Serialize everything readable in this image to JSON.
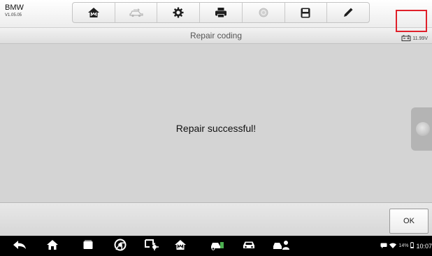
{
  "header": {
    "brand": "BMW",
    "version": "V1.05.05",
    "toolbar": [
      {
        "icon": "home-icon"
      },
      {
        "icon": "vehicle-swap-icon"
      },
      {
        "icon": "settings-gear-icon"
      },
      {
        "icon": "print-icon"
      },
      {
        "icon": "help-icon"
      },
      {
        "icon": "save-icon"
      },
      {
        "icon": "edit-pen-icon"
      }
    ]
  },
  "titlebar": {
    "title": "Repair coding",
    "battery_voltage": "11.99V",
    "battery_icon": "car-battery-icon"
  },
  "main": {
    "message": "Repair successful!"
  },
  "actions": {
    "ok_label": "OK",
    "highlight_color": "#e0202a"
  },
  "navbar": {
    "icons": [
      "back-icon",
      "android-home-icon",
      "recent-apps-icon",
      "chrome-icon",
      "vci-connection-icon",
      "autel-home-icon",
      "vehicle-service-icon",
      "car-icon",
      "vehicle-user-icon"
    ],
    "battery_percent": "14%",
    "time": "10:07"
  }
}
